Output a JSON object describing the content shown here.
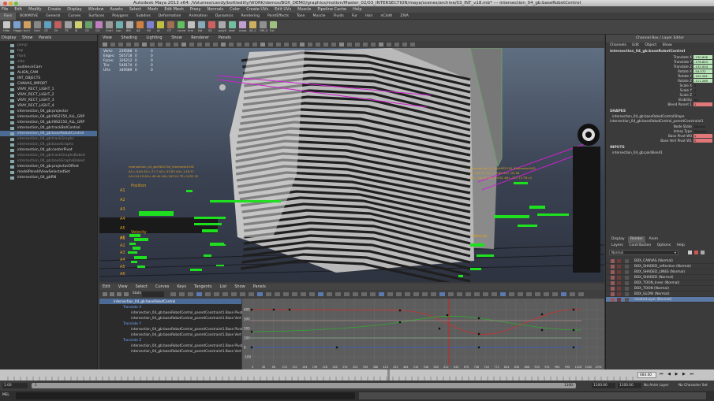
{
  "window": {
    "title": "Autodesk Maya 2013 x64: /Volumes/candy/bottledilly/WORK/demos/BOX_DEMO/graphics/motion/Master_02/03_INTERSECTION/maya/scenes/archive/03_INT_v18.mb* --- intersection_04_gb:baseRobotControl"
  },
  "menubar": [
    "File",
    "Edit",
    "Modify",
    "Create",
    "Display",
    "Window",
    "Assets",
    "Select",
    "Mesh",
    "Edit Mesh",
    "Proxy",
    "Normals",
    "Color",
    "Create UVs",
    "Edit UVs",
    "Muscle",
    "Pipeline Cache",
    "Help"
  ],
  "shelf_tabs": [
    "Favs",
    "BOXMOVE",
    "General",
    "Curves",
    "Surfaces",
    "Polygons",
    "Subdivs",
    "Deformation",
    "Animation",
    "Dynamics",
    "Rendering",
    "PaintEffects",
    "Toon",
    "Muscle",
    "Fluids",
    "Fur",
    "Hair",
    "nCloth",
    "ZIVA"
  ],
  "shelf_labels": [
    "Hide",
    "Higgin",
    "Incrl",
    "Grid",
    "CE",
    "DI",
    "TS",
    "SI",
    "CE",
    "CO",
    "Cntrl",
    "Lap",
    "BM",
    "AE",
    "HS",
    "AI",
    "CP",
    "curve",
    "hrm",
    "Nd",
    "SS",
    "polyX",
    "shdr",
    "mass",
    "AE_C",
    "ORI_E",
    "Ext"
  ],
  "outliner": {
    "menu": [
      "Display",
      "Show",
      "Panels"
    ],
    "items": [
      {
        "label": "persp",
        "dim": true
      },
      {
        "label": "top",
        "dim": true
      },
      {
        "label": "front",
        "dim": true
      },
      {
        "label": "side",
        "dim": true
      },
      {
        "label": "audienceCam",
        "dim": false
      },
      {
        "label": "ALIGN_CAM",
        "dim": false
      },
      {
        "label": "INT_OBJECTS",
        "dim": false
      },
      {
        "label": "CANVAS_IMPORT",
        "dim": false
      },
      {
        "label": "VRAY_RECT_LIGHT_1",
        "dim": false
      },
      {
        "label": "VRAY_RECT_LIGHT_2",
        "dim": false
      },
      {
        "label": "VRAY_RECT_LIGHT_3",
        "dim": false
      },
      {
        "label": "VRAY_RECT_LIGHT_4",
        "dim": false
      },
      {
        "label": "intersection_04_gb:projector",
        "dim": false
      },
      {
        "label": "intersection_04_gb:INS2150_ALL_GRP",
        "dim": false
      },
      {
        "label": "intersection_04_gb:INS2150_ALL_GRP",
        "dim": false
      },
      {
        "label": "intersection_04_gb:trackBotControl",
        "dim": false
      },
      {
        "label": "intersection_04_gb:baseRobotControl",
        "dim": false,
        "selected": true
      },
      {
        "label": "intersection_04_gb:trackGraphs",
        "dim": true
      },
      {
        "label": "intersection_04_gb:baseGraphs",
        "dim": true
      },
      {
        "label": "intersection_04_gb:centerPivot",
        "dim": false
      },
      {
        "label": "intersection_04_gb:trackGraphsBaked",
        "dim": true
      },
      {
        "label": "intersection_04_gb:baseGraphsBaked",
        "dim": true
      },
      {
        "label": "intersection_04_gb:projectorOffset",
        "dim": false
      },
      {
        "label": "modelPanel4ViewSelectedSet",
        "dim": false
      },
      {
        "label": "intersection_04_gbRN",
        "dim": false
      }
    ]
  },
  "viewport": {
    "menu": [
      "View",
      "Shading",
      "Lighting",
      "Show",
      "Renderer",
      "Panels"
    ],
    "hud": {
      "rows": [
        {
          "k": "Verts:",
          "a": "239588",
          "b": "0",
          "c": "0"
        },
        {
          "k": "Edges:",
          "a": "565718",
          "b": "0",
          "c": "0"
        },
        {
          "k": "Faces:",
          "a": "326212",
          "b": "0",
          "c": "0"
        },
        {
          "k": "Tris:",
          "a": "548174",
          "b": "0",
          "c": "0"
        },
        {
          "k": "UVs:",
          "a": "349589",
          "b": "0",
          "c": "0"
        }
      ]
    },
    "readout_left": {
      "title": "intersection_04_gb:INS2150_KinematicHUD",
      "line1": "A1=-0.64  A2=-71.7  A3=-33.83  A4=-118.37",
      "line2": "A4=24.19  A5=-40.44  A6=163.24  TR=1452.32"
    },
    "readout_right": {
      "title": "intersection_04_gb:INS2150_KinematicHUD",
      "line1": "A1=85.31  A2=-73.82  A3=-32.98",
      "line2": "A4=-18.11  A5=-49.81  A6=-177.73  TR=0"
    },
    "position_label": "Position",
    "velocity_label": "Velocity",
    "axis_labels": [
      "A1",
      "A2",
      "A3",
      "A4",
      "A5",
      "A6",
      "A7"
    ],
    "accent_green": "#1fe01f",
    "accent_magenta": "#d020d0"
  },
  "channel_box": {
    "header": "Channel Box / Layer Editor",
    "menu": [
      "Channels",
      "Edit",
      "Object",
      "Show"
    ],
    "object": "intersection_04_gb:baseRobotControl",
    "channels": [
      {
        "name": "Translate X",
        "value": "-130.606",
        "style": "green"
      },
      {
        "name": "Translate Y",
        "value": "-176.843",
        "style": "green"
      },
      {
        "name": "Translate Z",
        "value": "-132.004",
        "style": "green"
      },
      {
        "name": "Rotate X",
        "value": "-54.072",
        "style": "green"
      },
      {
        "name": "Rotate Y",
        "value": "-102.281",
        "style": "green"
      },
      {
        "name": "Rotate Z",
        "value": "-111.265",
        "style": "green"
      },
      {
        "name": "Scale X",
        "value": "1",
        "style": "none"
      },
      {
        "name": "Scale Y",
        "value": "1",
        "style": "none"
      },
      {
        "name": "Scale Z",
        "value": "1",
        "style": "none"
      },
      {
        "name": "Visibility",
        "value": "on",
        "style": "none"
      },
      {
        "name": "Blend Parent 1",
        "value": "1",
        "style": "red"
      }
    ],
    "shapes_title": "SHAPES",
    "shapes": [
      "intersection_04_gb:baseRobotControlShape",
      "intersection_04_gb:baseRobotControl_parentConstraint1"
    ],
    "constraint_attrs": [
      {
        "name": "Node State",
        "value": "Normal"
      },
      {
        "name": "Interp Type",
        "value": "Average"
      },
      {
        "name": "Base Pivot W0",
        "value": "1"
      },
      {
        "name": "Base Vert Pivot W1",
        "value": "0"
      }
    ],
    "inputs_title": "INPUTS",
    "inputs": [
      "intersection_04_gb:pairBlend1"
    ]
  },
  "layer_editor": {
    "tabs": [
      "Display",
      "Render",
      "Anim"
    ],
    "active_tab": "Render",
    "menu": [
      "Layers",
      "Contribution",
      "Options",
      "Help"
    ],
    "mode": "Normal",
    "layers": [
      {
        "name": "BOX_CANVAS (Normal)",
        "selected": false
      },
      {
        "name": "BOX_SHADED_reflection (Normal)",
        "selected": false
      },
      {
        "name": "BOX_SHADED_LINES (Normal)",
        "selected": false
      },
      {
        "name": "BOX_SHADED (Normal)",
        "selected": false
      },
      {
        "name": "BOX_TOON_Inner (Normal)",
        "selected": false
      },
      {
        "name": "BOX_TOON (Normal)",
        "selected": false
      },
      {
        "name": "BOX_GLOW (Normal)",
        "selected": false
      },
      {
        "name": "masterLayer (Normal)",
        "selected": true
      }
    ]
  },
  "graph_editor": {
    "menu": [
      "Edit",
      "View",
      "Select",
      "Curves",
      "Keys",
      "Tangents",
      "List",
      "Show",
      "Panels"
    ],
    "stats_label": "Stats",
    "outline": [
      {
        "label": "intersection_04_gb:baseRobotControl",
        "kind": "head"
      },
      {
        "label": "Translate X",
        "kind": "group"
      },
      {
        "label": "intersection_04_gb:baseRobotControl_parentConstraint1.Base Pivot W0",
        "kind": "item"
      },
      {
        "label": "intersection_04_gb:baseRobotControl_parentConstraint1.Base Vert Pivot W1",
        "kind": "item"
      },
      {
        "label": "Translate Y",
        "kind": "group"
      },
      {
        "label": "intersection_04_gb:baseRobotControl_parentConstraint1.Base Pivot W0",
        "kind": "item"
      },
      {
        "label": "intersection_04_gb:baseRobotControl_parentConstraint1.Base Vert Pivot W1",
        "kind": "item"
      },
      {
        "label": "Translate Z",
        "kind": "group"
      },
      {
        "label": "intersection_04_gb:baseRobotControl_parentConstraint1.Base Pivot W0",
        "kind": "item"
      },
      {
        "label": "intersection_04_gb:baseRobotControl_parentConstraint1.Base Vert Pivot W1",
        "kind": "item"
      }
    ],
    "y_ticks": [
      "400",
      "300",
      "200",
      "100",
      "0",
      "-100"
    ],
    "x_ticks": [
      "4",
      "36",
      "68",
      "100",
      "132",
      "164",
      "196",
      "228",
      "260",
      "292",
      "324",
      "356",
      "388",
      "420",
      "452",
      "484",
      "516",
      "548",
      "580",
      "612",
      "644",
      "676",
      "708",
      "740",
      "772",
      "804",
      "836",
      "868",
      "900",
      "932",
      "964",
      "996",
      "1028",
      "1060",
      "1092"
    ],
    "current_frame_marker": "684"
  },
  "time_slider": {
    "current_frame": "684.00",
    "start": "1.00",
    "range_start": "1",
    "range_end": "1100",
    "end": "1100.00",
    "end2": "1100.00",
    "anim_layer": "No Anim Layer",
    "char_set": "No Character Set"
  },
  "command_line": {
    "language": "MEL"
  }
}
